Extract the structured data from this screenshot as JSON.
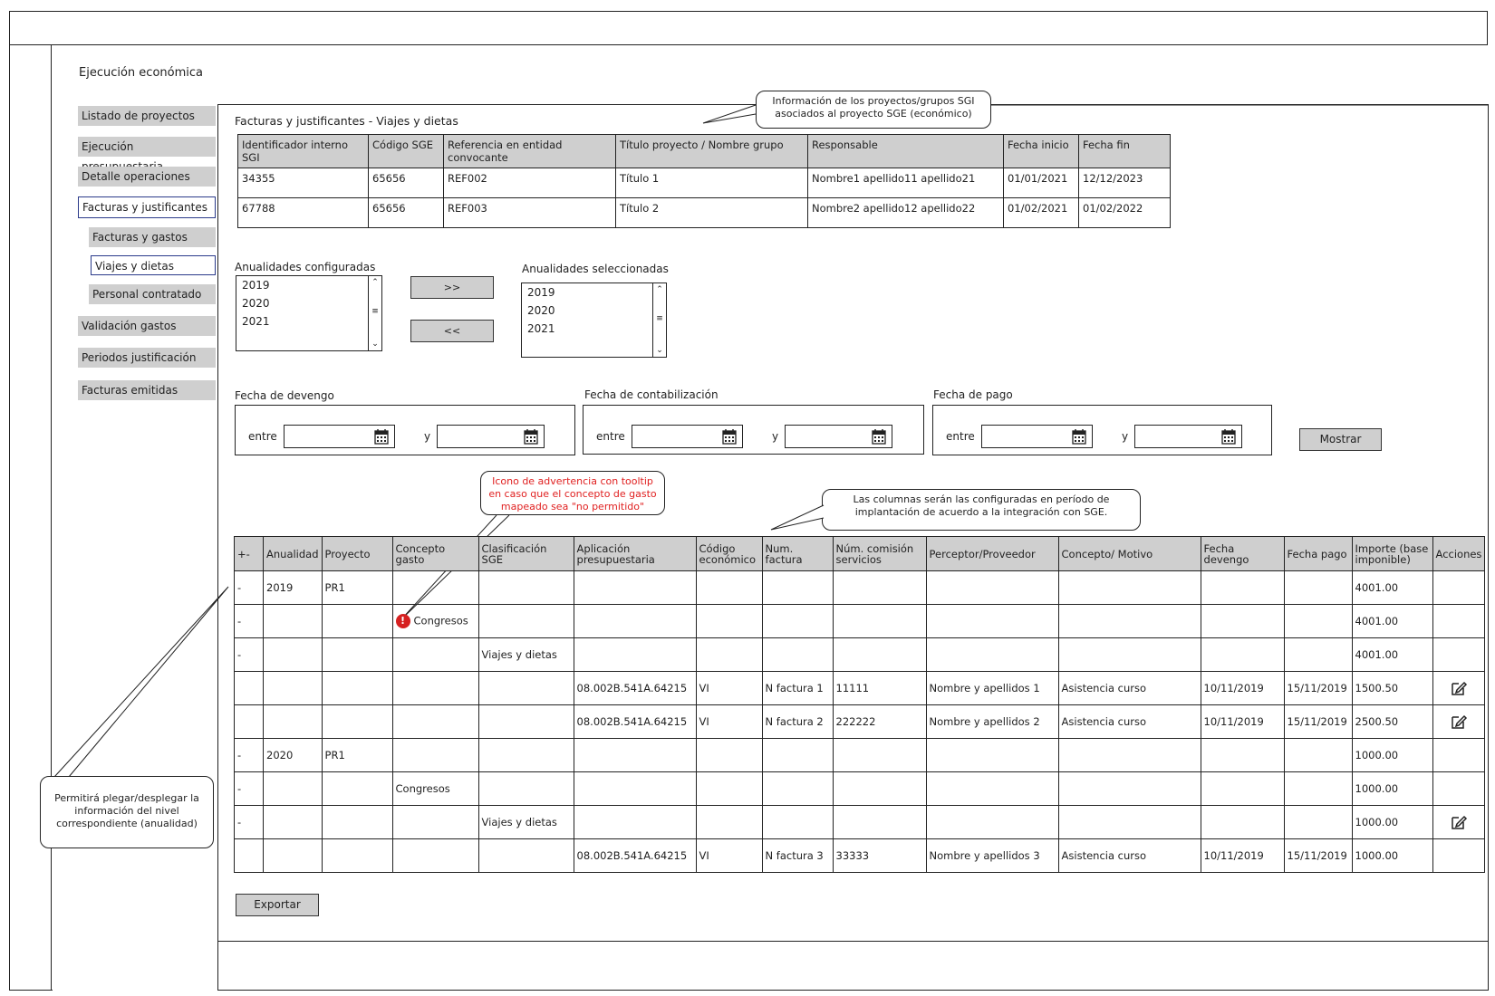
{
  "page": {
    "title": "Ejecución económica"
  },
  "sidebar": {
    "items": [
      {
        "label": "Listado de proyectos"
      },
      {
        "label": "Ejecución presupuestaria"
      },
      {
        "label": "Detalle operaciones"
      },
      {
        "label": "Facturas y justificantes"
      },
      {
        "label": "Facturas y gastos"
      },
      {
        "label": "Viajes y dietas"
      },
      {
        "label": "Personal contratado"
      },
      {
        "label": "Validación gastos"
      },
      {
        "label": "Periodos justificación"
      },
      {
        "label": "Facturas emitidas"
      }
    ]
  },
  "section": {
    "title": "Facturas y justificantes - Viajes y dietas"
  },
  "projects_table": {
    "headers": [
      "Identificador interno SGI",
      "Código SGE",
      "Referencia en entidad convocante",
      "Título proyecto / Nombre grupo",
      "Responsable",
      "Fecha inicio",
      "Fecha fin"
    ],
    "rows": [
      [
        "34355",
        "65656",
        "REF002",
        "Título 1",
        "Nombre1 apellido11 apellido21",
        "01/01/2021",
        "12/12/2023"
      ],
      [
        "67788",
        "65656",
        "REF003",
        "Título 2",
        "Nombre2 apellido12 apellido22",
        "01/02/2021",
        "01/02/2022"
      ]
    ]
  },
  "annualities": {
    "configured_label": "Anualidades configuradas",
    "configured": [
      "2019",
      "2020",
      "2021"
    ],
    "selected_label": "Anualidades seleccionadas",
    "selected": [
      "2019",
      "2020",
      "2021"
    ],
    "add_label": ">>",
    "remove_label": "<<"
  },
  "filters": {
    "devengo_label": "Fecha de devengo",
    "contabilizacion_label": "Fecha de contabilización",
    "pago_label": "Fecha de pago",
    "between_label": "entre",
    "and_label": "y",
    "show_button": "Mostrar"
  },
  "expenses_table": {
    "headers": [
      "+-",
      "Anualidad",
      "Proyecto",
      "Concepto gasto",
      "Clasificación SGE",
      "Aplicación presupuestaria",
      "Código económico",
      "Num. factura",
      "Núm. comisión servicios",
      "Perceptor/Proveedor",
      "Concepto/ Motivo",
      "Fecha devengo",
      "Fecha pago",
      "Importe (base imponible)",
      "Acciones"
    ],
    "rows": [
      {
        "cells": [
          "-",
          "2019",
          "PR1",
          "",
          "",
          "",
          "",
          "",
          "",
          "",
          "",
          "",
          "",
          "4001.00"
        ],
        "warn": false,
        "edit": false
      },
      {
        "cells": [
          "-",
          "",
          "",
          "Congresos",
          "",
          "",
          "",
          "",
          "",
          "",
          "",
          "",
          "",
          "4001.00"
        ],
        "warn": true,
        "edit": false
      },
      {
        "cells": [
          "-",
          "",
          "",
          "",
          "Viajes y dietas",
          "",
          "",
          "",
          "",
          "",
          "",
          "",
          "",
          "4001.00"
        ],
        "warn": false,
        "edit": false
      },
      {
        "cells": [
          "",
          "",
          "",
          "",
          "",
          "08.002B.541A.64215",
          "VI",
          "N factura 1",
          "11111",
          "Nombre y apellidos 1",
          "Asistencia curso",
          "10/11/2019",
          "15/11/2019",
          "1500.50"
        ],
        "warn": false,
        "edit": true
      },
      {
        "cells": [
          "",
          "",
          "",
          "",
          "",
          "08.002B.541A.64215",
          "VI",
          "N factura 2",
          "222222",
          "Nombre y apellidos 2",
          "Asistencia curso",
          "10/11/2019",
          "15/11/2019",
          "2500.50"
        ],
        "warn": false,
        "edit": true
      },
      {
        "cells": [
          "-",
          "2020",
          "PR1",
          "",
          "",
          "",
          "",
          "",
          "",
          "",
          "",
          "",
          "",
          "1000.00"
        ],
        "warn": false,
        "edit": false
      },
      {
        "cells": [
          "-",
          "",
          "",
          "Congresos",
          "",
          "",
          "",
          "",
          "",
          "",
          "",
          "",
          "",
          "1000.00"
        ],
        "warn": false,
        "edit": false
      },
      {
        "cells": [
          "-",
          "",
          "",
          "",
          "Viajes y dietas",
          "",
          "",
          "",
          "",
          "",
          "",
          "",
          "",
          "1000.00"
        ],
        "warn": false,
        "edit": true
      },
      {
        "cells": [
          "",
          "",
          "",
          "",
          "",
          "08.002B.541A.64215",
          "VI",
          "N factura 3",
          "33333",
          "Nombre y apellidos 3",
          "Asistencia curso",
          "10/11/2019",
          "15/11/2019",
          "1000.00"
        ],
        "warn": false,
        "edit": false
      }
    ]
  },
  "export_button": "Exportar",
  "annotations": {
    "projects_info": "Información de los proyectos/grupos SGI asociados al proyecto SGE (económico)",
    "columns_info": "Las columnas serán las configuradas en período de implantación de acuerdo a la integración con SGE.",
    "warning_info": "Icono de advertencia con tooltip en caso que el concepto de gasto mapeado sea \"no permitido\"",
    "collapse_info": "Permitirá plegar/desplegar la información del nivel correspondiente (anualidad)"
  },
  "colors": {
    "menu_bg": "#cfcfcf",
    "active_border": "#2a3a8a",
    "warning": "#d62020",
    "annotation_red": "#e02020"
  }
}
